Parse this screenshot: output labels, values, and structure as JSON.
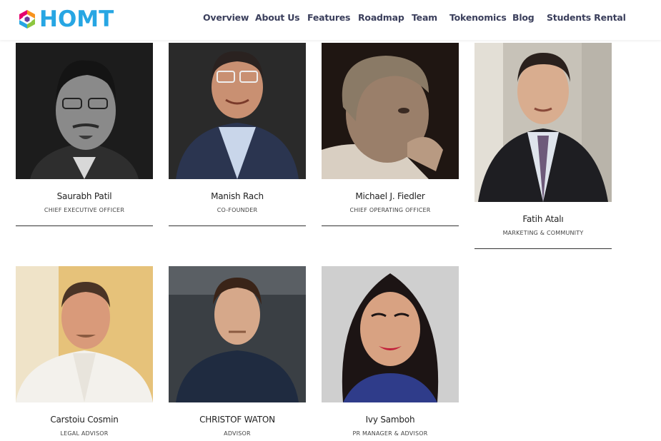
{
  "header": {
    "logo_text": "HOMT",
    "nav": [
      {
        "label": "Overview",
        "icon": ""
      },
      {
        "label": "About Us"
      },
      {
        "label": "Features"
      },
      {
        "label": "Roadmap"
      },
      {
        "label": "Team"
      },
      {
        "label": "Tokenomics"
      },
      {
        "label": "Blog"
      },
      {
        "label": "Students Rental"
      }
    ]
  },
  "team": {
    "members": [
      {
        "name": "Saurabh Patil",
        "role": "CHIEF EXECUTIVE OFFICER"
      },
      {
        "name": "Manish Rach",
        "role": "CO-FOUNDER"
      },
      {
        "name": "Michael J. Fiedler",
        "role": "CHIEF OPERATING OFFICER"
      },
      {
        "name": "Fatih Atalı",
        "role": "MARKETING & COMMUNITY"
      },
      {
        "name": "Carstoiu Cosmin",
        "role": "LEGAL ADVISOR"
      },
      {
        "name": "CHRISTOF WATON",
        "role": "ADVISOR"
      },
      {
        "name": "Ivy Samboh",
        "role": "PR MANAGER & ADVISOR"
      }
    ]
  },
  "colors": {
    "logo_blue": "#27a6e3",
    "nav_text": "#3b3f5c",
    "divider": "#333333"
  }
}
